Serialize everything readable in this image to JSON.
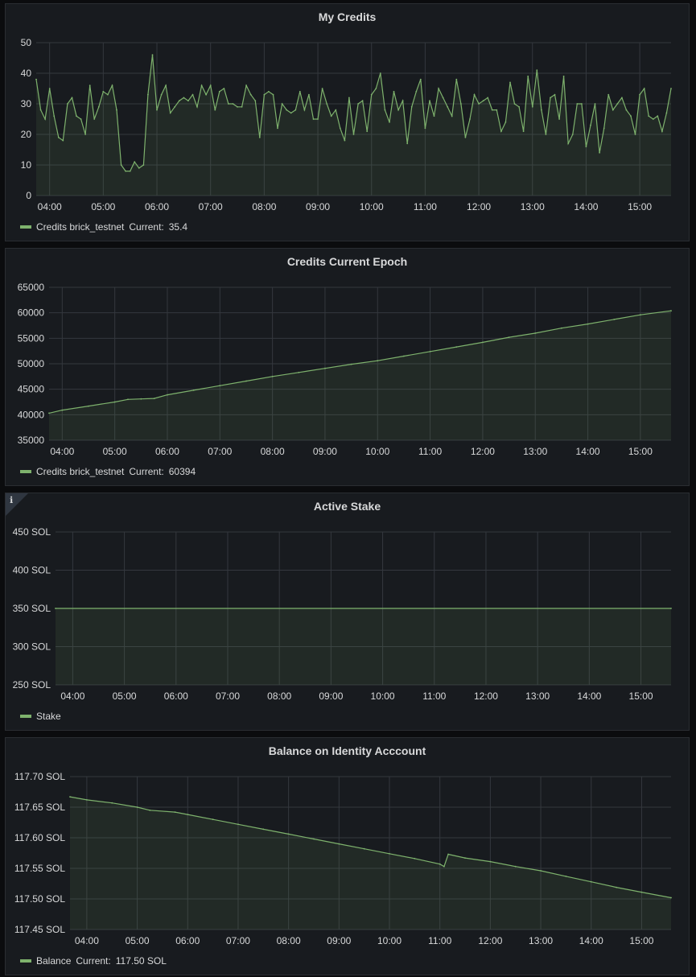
{
  "colors": {
    "series": "#7eb26d",
    "grid": "#34383e",
    "panel": "#181b1f",
    "text": "#d8d9da"
  },
  "panels": [
    {
      "title": "My Credits",
      "legend": {
        "series_name": "Credits brick_testnet",
        "current_label": "Current:",
        "current_value": "35.4"
      },
      "y_tick_labels": [
        "50",
        "40",
        "30",
        "20",
        "10",
        "0"
      ],
      "x_tick_labels": [
        "04:00",
        "05:00",
        "06:00",
        "07:00",
        "08:00",
        "09:00",
        "10:00",
        "11:00",
        "12:00",
        "13:00",
        "14:00",
        "15:00"
      ]
    },
    {
      "title": "Credits Current Epoch",
      "legend": {
        "series_name": "Credits brick_testnet",
        "current_label": "Current:",
        "current_value": "60394"
      },
      "y_tick_labels": [
        "65000",
        "60000",
        "55000",
        "50000",
        "45000",
        "40000",
        "35000"
      ],
      "x_tick_labels": [
        "04:00",
        "05:00",
        "06:00",
        "07:00",
        "08:00",
        "09:00",
        "10:00",
        "11:00",
        "12:00",
        "13:00",
        "14:00",
        "15:00"
      ]
    },
    {
      "title": "Active Stake",
      "info_icon": "info-icon",
      "info_glyph": "ℹ",
      "legend": {
        "series_name": "Stake",
        "current_label": "",
        "current_value": ""
      },
      "y_tick_labels": [
        "450 SOL",
        "400 SOL",
        "350 SOL",
        "300 SOL",
        "250 SOL"
      ],
      "x_tick_labels": [
        "04:00",
        "05:00",
        "06:00",
        "07:00",
        "08:00",
        "09:00",
        "10:00",
        "11:00",
        "12:00",
        "13:00",
        "14:00",
        "15:00"
      ]
    },
    {
      "title": "Balance on Identity Acccount",
      "legend": {
        "series_name": "Balance",
        "current_label": "Current:",
        "current_value": "117.50 SOL"
      },
      "y_tick_labels": [
        "117.70 SOL",
        "117.65 SOL",
        "117.60 SOL",
        "117.55 SOL",
        "117.50 SOL",
        "117.45 SOL"
      ],
      "x_tick_labels": [
        "04:00",
        "05:00",
        "06:00",
        "07:00",
        "08:00",
        "09:00",
        "10:00",
        "11:00",
        "12:00",
        "13:00",
        "14:00",
        "15:00"
      ]
    }
  ],
  "chart_data": [
    {
      "type": "area",
      "title": "My Credits",
      "ylim": [
        0,
        50
      ],
      "xlim": [
        "03:45",
        "15:35"
      ],
      "grid": true,
      "legend_position": "bottom-left",
      "series": [
        {
          "name": "Credits brick_testnet",
          "x": [
            "03:45",
            "03:50",
            "03:55",
            "04:00",
            "04:05",
            "04:10",
            "04:15",
            "04:20",
            "04:25",
            "04:30",
            "04:35",
            "04:40",
            "04:45",
            "04:50",
            "04:55",
            "05:00",
            "05:05",
            "05:10",
            "05:15",
            "05:20",
            "05:25",
            "05:30",
            "05:35",
            "05:40",
            "05:45",
            "05:50",
            "05:55",
            "06:00",
            "06:05",
            "06:10",
            "06:15",
            "06:20",
            "06:25",
            "06:30",
            "06:35",
            "06:40",
            "06:45",
            "06:50",
            "06:55",
            "07:00",
            "07:05",
            "07:10",
            "07:15",
            "07:20",
            "07:25",
            "07:30",
            "07:35",
            "07:40",
            "07:45",
            "07:50",
            "07:55",
            "08:00",
            "08:05",
            "08:10",
            "08:15",
            "08:20",
            "08:25",
            "08:30",
            "08:35",
            "08:40",
            "08:45",
            "08:50",
            "08:55",
            "09:00",
            "09:05",
            "09:10",
            "09:15",
            "09:20",
            "09:25",
            "09:30",
            "09:35",
            "09:40",
            "09:45",
            "09:50",
            "09:55",
            "10:00",
            "10:05",
            "10:10",
            "10:15",
            "10:20",
            "10:25",
            "10:30",
            "10:35",
            "10:40",
            "10:45",
            "10:50",
            "10:55",
            "11:00",
            "11:05",
            "11:10",
            "11:15",
            "11:20",
            "11:25",
            "11:30",
            "11:35",
            "11:40",
            "11:45",
            "11:50",
            "11:55",
            "12:00",
            "12:05",
            "12:10",
            "12:15",
            "12:20",
            "12:25",
            "12:30",
            "12:35",
            "12:40",
            "12:45",
            "12:50",
            "12:55",
            "13:00",
            "13:05",
            "13:10",
            "13:15",
            "13:20",
            "13:25",
            "13:30",
            "13:35",
            "13:40",
            "13:45",
            "13:50",
            "13:55",
            "14:00",
            "14:05",
            "14:10",
            "14:15",
            "14:20",
            "14:25",
            "14:30",
            "14:35",
            "14:40",
            "14:45",
            "14:50",
            "14:55",
            "15:00",
            "15:05",
            "15:10",
            "15:15",
            "15:20",
            "15:25",
            "15:30",
            "15:35"
          ],
          "values": [
            38,
            28,
            25,
            35,
            26,
            19,
            18,
            30,
            32,
            26,
            25,
            20,
            36,
            25,
            29,
            34,
            33,
            36,
            28,
            10,
            8,
            8,
            11,
            9,
            10,
            33,
            46,
            28,
            33,
            36,
            27,
            29,
            31,
            32,
            31,
            33,
            29,
            36,
            33,
            36,
            28,
            34,
            35,
            30,
            30,
            29,
            29,
            36,
            33,
            31,
            19,
            33,
            34,
            33,
            22,
            30,
            28,
            27,
            28,
            34,
            28,
            33,
            25,
            25,
            35,
            30,
            26,
            28,
            22,
            18,
            32,
            20,
            30,
            31,
            21,
            33,
            35,
            40,
            28,
            24,
            34,
            28,
            31,
            17,
            29,
            34,
            38,
            22,
            31,
            26,
            35,
            32,
            29,
            26,
            38,
            30,
            19,
            25,
            33,
            30,
            31,
            32,
            28,
            28,
            21,
            24,
            37,
            30,
            29,
            21,
            39,
            29,
            41,
            28,
            20,
            32,
            33,
            25,
            39,
            17,
            20,
            30,
            30,
            16,
            23,
            30,
            14,
            22,
            33,
            28,
            30,
            32,
            28,
            26,
            20,
            33,
            35,
            26,
            25,
            26,
            21,
            27,
            35
          ]
        }
      ]
    },
    {
      "type": "area",
      "title": "Credits Current Epoch",
      "ylim": [
        35000,
        65000
      ],
      "xlim": [
        "03:45",
        "15:35"
      ],
      "grid": true,
      "legend_position": "bottom-left",
      "series": [
        {
          "name": "Credits brick_testnet",
          "x": [
            "03:45",
            "04:00",
            "04:30",
            "05:00",
            "05:15",
            "05:30",
            "05:45",
            "06:00",
            "06:30",
            "07:00",
            "07:30",
            "08:00",
            "08:30",
            "09:00",
            "09:30",
            "10:00",
            "10:30",
            "11:00",
            "11:30",
            "12:00",
            "12:30",
            "13:00",
            "13:30",
            "14:00",
            "14:30",
            "15:00",
            "15:35"
          ],
          "values": [
            40300,
            40900,
            41700,
            42500,
            43000,
            43100,
            43200,
            43900,
            44800,
            45700,
            46600,
            47500,
            48300,
            49100,
            49900,
            50600,
            51500,
            52400,
            53300,
            54200,
            55200,
            56000,
            57000,
            57800,
            58700,
            59600,
            60394
          ]
        }
      ]
    },
    {
      "type": "area",
      "title": "Active Stake",
      "ylim": [
        250,
        450
      ],
      "xlim": [
        "03:40",
        "15:35"
      ],
      "grid": true,
      "legend_position": "bottom-left",
      "series": [
        {
          "name": "Stake",
          "x": [
            "03:40",
            "15:35"
          ],
          "values": [
            350,
            350
          ]
        }
      ]
    },
    {
      "type": "area",
      "title": "Balance on Identity Acccount",
      "ylim": [
        117.45,
        117.7
      ],
      "xlim": [
        "03:40",
        "15:35"
      ],
      "grid": true,
      "legend_position": "bottom-left",
      "series": [
        {
          "name": "Balance",
          "x": [
            "03:40",
            "04:00",
            "04:30",
            "05:00",
            "05:15",
            "05:45",
            "06:00",
            "06:30",
            "07:00",
            "07:30",
            "08:00",
            "08:30",
            "09:00",
            "09:30",
            "10:00",
            "10:30",
            "11:00",
            "11:05",
            "11:10",
            "11:30",
            "12:00",
            "12:30",
            "13:00",
            "13:30",
            "14:00",
            "14:30",
            "15:00",
            "15:35"
          ],
          "values": [
            117.667,
            117.662,
            117.657,
            117.65,
            117.645,
            117.642,
            117.638,
            117.63,
            117.622,
            117.614,
            117.606,
            117.598,
            117.59,
            117.582,
            117.574,
            117.566,
            117.557,
            117.553,
            117.573,
            117.567,
            117.561,
            117.553,
            117.546,
            117.537,
            117.528,
            117.519,
            117.511,
            117.502
          ]
        }
      ]
    }
  ]
}
